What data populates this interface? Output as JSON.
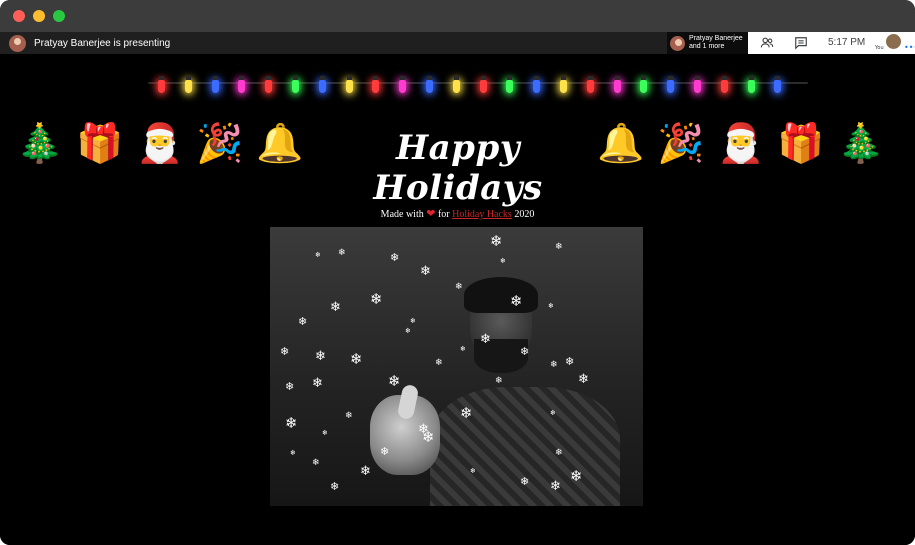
{
  "meet_bar": {
    "presenting_text": "Pratyay Banerjee is presenting",
    "participants_line1": "Pratyay Banerjee",
    "participants_line2": "and 1 more",
    "time": "5:17 PM",
    "you_label": "You"
  },
  "icons": [
    "people-icon",
    "chat-icon",
    "more-icon",
    "christmas-tree-icon",
    "gift-icon",
    "santa-icon",
    "party-popper-icon",
    "bell-icon"
  ],
  "page": {
    "title": "Happy Holidays",
    "made_with_text": "Made with",
    "heart": "❤",
    "for_text": "for",
    "link_text": "Holiday Hacks",
    "year": "2020"
  },
  "decorations": {
    "emoji_left": [
      "🎄",
      "🎁",
      "🎅",
      "🎉",
      "🔔"
    ],
    "emoji_right": [
      "🔔",
      "🎉",
      "🎅",
      "🎁",
      "🎄"
    ],
    "bulb_colors": [
      "#ff3b3b",
      "#ffe14a",
      "#3b6bff",
      "#ff3bd0",
      "#ff3b3b",
      "#3bff5a",
      "#3b6bff",
      "#ffe14a",
      "#ff3b3b",
      "#ff3bd0",
      "#3b6bff",
      "#ffe14a",
      "#ff3b3b",
      "#3bff5a",
      "#3b6bff",
      "#ffe14a",
      "#ff3b3b",
      "#ff3bd0",
      "#3bff5a",
      "#3b6bff",
      "#ff3bd0",
      "#ff3b3b",
      "#3bff5a",
      "#3b6bff"
    ],
    "snowflake_glyph": "❄"
  },
  "colors": {
    "background": "#000000",
    "title": "#ffffff",
    "link": "#c62828",
    "heart": "#e0242f"
  }
}
